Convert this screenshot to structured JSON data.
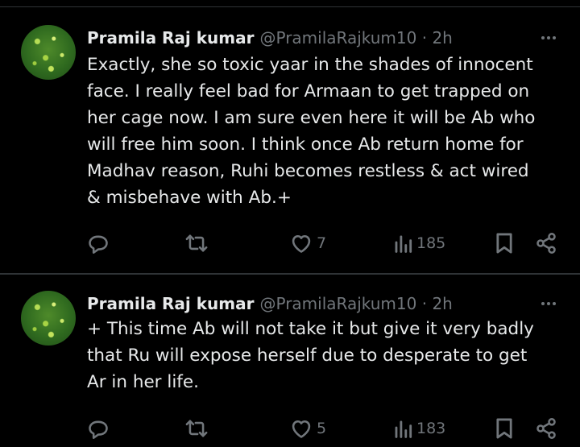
{
  "tweets": [
    {
      "name": "Pramila Raj kumar",
      "handle": "@PramilaRajkum10 · 2h",
      "text": "Exactly, she so toxic yaar in the shades of innocent\nface. I really feel bad for Armaan to get trapped on\nher cage now. I am sure even here it will be Ab who\nwill free him soon. I think once Ab return home for\nMadhav reason, Ruhi becomes restless & act wired\n& misbehave with Ab.+",
      "likes": "7",
      "views": "185"
    },
    {
      "name": "Pramila Raj kumar",
      "handle": "@PramilaRajkum10 · 2h",
      "text": "+ This time Ab will not take it but give it very badly\nthat Ru will expose herself due to desperate to get\nAr in her life.",
      "likes": "5",
      "views": "183"
    }
  ],
  "icons": {
    "reply": "speech-bubble",
    "retweet": "two-arrows-loop",
    "like": "heart",
    "views": "bar-chart",
    "bookmark": "bookmark",
    "share": "share-nodes",
    "more": "three-dots"
  },
  "colors": {
    "background": "#000000",
    "text": "#e7e9ea",
    "muted": "#71767b",
    "divider": "#2f3336"
  }
}
